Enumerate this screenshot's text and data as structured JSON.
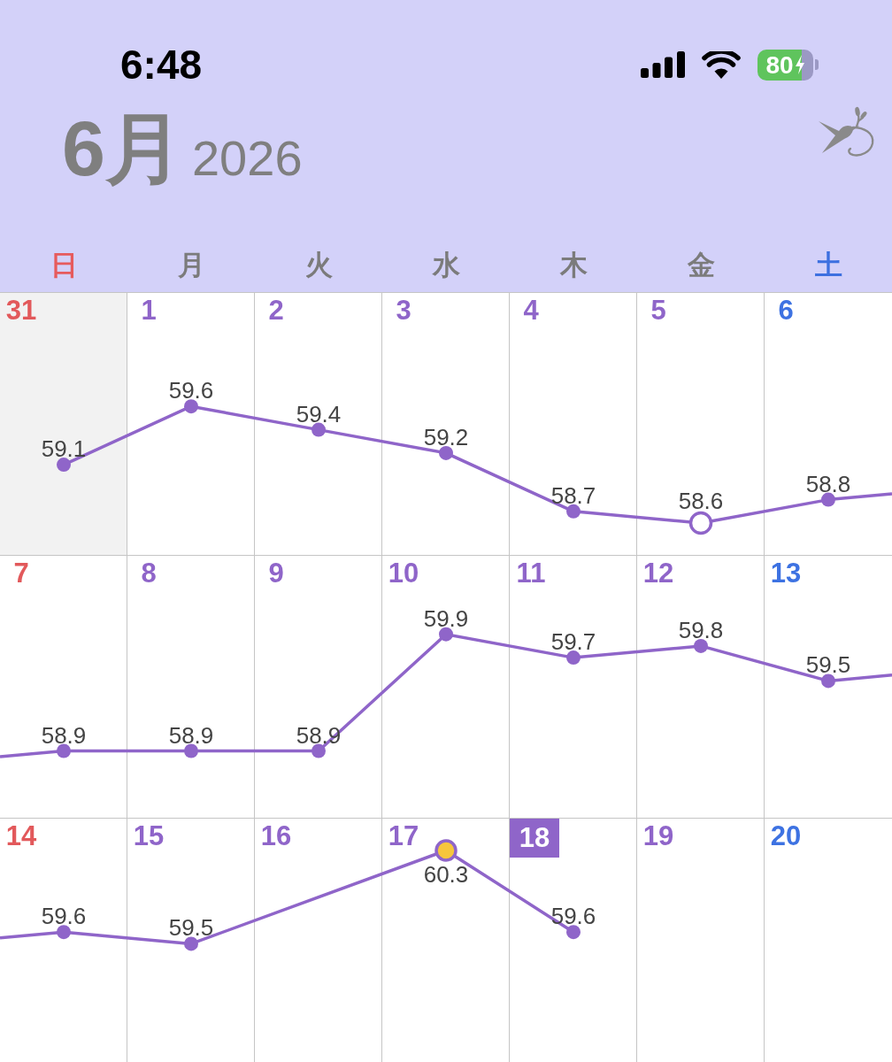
{
  "status_bar": {
    "time": "6:48",
    "battery": "80",
    "charging": true
  },
  "header": {
    "month": "6月",
    "year": "2026"
  },
  "calendar": {
    "weekdays": [
      {
        "label": "日",
        "kind": "sunday"
      },
      {
        "label": "月",
        "kind": "weekday"
      },
      {
        "label": "火",
        "kind": "weekday"
      },
      {
        "label": "水",
        "kind": "weekday"
      },
      {
        "label": "木",
        "kind": "weekday"
      },
      {
        "label": "金",
        "kind": "weekday"
      },
      {
        "label": "土",
        "kind": "saturday"
      }
    ],
    "weeks": [
      {
        "days": [
          {
            "date": "31",
            "outside_month": true,
            "today": false,
            "reading": "59.1",
            "kind": "dot"
          },
          {
            "date": "1",
            "outside_month": false,
            "today": false,
            "reading": "59.6",
            "kind": "dot"
          },
          {
            "date": "2",
            "outside_month": false,
            "today": false,
            "reading": "59.4",
            "kind": "dot"
          },
          {
            "date": "3",
            "outside_month": false,
            "today": false,
            "reading": "59.2",
            "kind": "dot"
          },
          {
            "date": "4",
            "outside_month": false,
            "today": false,
            "reading": "58.7",
            "kind": "dot"
          },
          {
            "date": "5",
            "outside_month": false,
            "today": false,
            "reading": "58.6",
            "kind": "open"
          },
          {
            "date": "6",
            "outside_month": false,
            "today": false,
            "reading": "58.8",
            "kind": "dot"
          }
        ]
      },
      {
        "days": [
          {
            "date": "7",
            "outside_month": false,
            "today": false,
            "reading": "58.9",
            "kind": "dot"
          },
          {
            "date": "8",
            "outside_month": false,
            "today": false,
            "reading": "58.9",
            "kind": "dot"
          },
          {
            "date": "9",
            "outside_month": false,
            "today": false,
            "reading": "58.9",
            "kind": "dot"
          },
          {
            "date": "10",
            "outside_month": false,
            "today": false,
            "reading": "59.9",
            "kind": "dot"
          },
          {
            "date": "11",
            "outside_month": false,
            "today": false,
            "reading": "59.7",
            "kind": "dot"
          },
          {
            "date": "12",
            "outside_month": false,
            "today": false,
            "reading": "59.8",
            "kind": "dot"
          },
          {
            "date": "13",
            "outside_month": false,
            "today": false,
            "reading": "59.5",
            "kind": "dot"
          }
        ]
      },
      {
        "days": [
          {
            "date": "14",
            "outside_month": false,
            "today": false,
            "reading": "59.6",
            "kind": "dot"
          },
          {
            "date": "15",
            "outside_month": false,
            "today": false,
            "reading": "59.5",
            "kind": "dot"
          },
          {
            "date": "16",
            "outside_month": false,
            "today": false
          },
          {
            "date": "17",
            "outside_month": false,
            "today": false,
            "reading": "60.3",
            "kind": "gold"
          },
          {
            "date": "18",
            "outside_month": false,
            "today": true,
            "reading": "59.6",
            "kind": "dot"
          },
          {
            "date": "19",
            "outside_month": false,
            "today": false
          },
          {
            "date": "20",
            "outside_month": false,
            "today": false
          }
        ]
      }
    ]
  }
}
